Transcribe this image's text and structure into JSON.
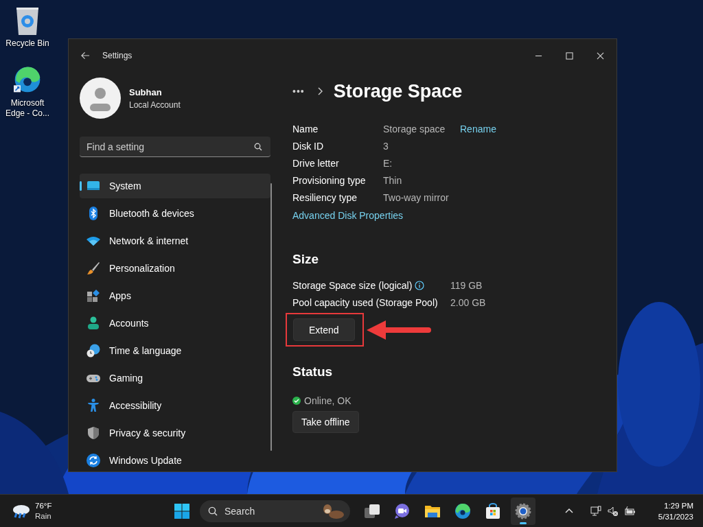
{
  "desktop_icons": [
    {
      "kind": "recycle",
      "label": "Recycle Bin"
    },
    {
      "kind": "edge",
      "label": "Microsoft Edge - Co..."
    }
  ],
  "window": {
    "title": "Settings"
  },
  "account": {
    "name": "Subhan",
    "type": "Local Account"
  },
  "search": {
    "placeholder": "Find a setting"
  },
  "nav": [
    {
      "kind": "system",
      "label": "System",
      "selected": true
    },
    {
      "kind": "bluetooth",
      "label": "Bluetooth & devices",
      "selected": false
    },
    {
      "kind": "network",
      "label": "Network & internet",
      "selected": false
    },
    {
      "kind": "personalization",
      "label": "Personalization",
      "selected": false
    },
    {
      "kind": "apps",
      "label": "Apps",
      "selected": false
    },
    {
      "kind": "accounts",
      "label": "Accounts",
      "selected": false
    },
    {
      "kind": "time",
      "label": "Time & language",
      "selected": false
    },
    {
      "kind": "gaming",
      "label": "Gaming",
      "selected": false
    },
    {
      "kind": "accessibility",
      "label": "Accessibility",
      "selected": false
    },
    {
      "kind": "privacy",
      "label": "Privacy & security",
      "selected": false
    },
    {
      "kind": "update",
      "label": "Windows Update",
      "selected": false
    }
  ],
  "breadcrumb": {
    "overflow": "•••",
    "title": "Storage Space"
  },
  "properties": [
    {
      "label": "Name",
      "value": "Storage space",
      "action": "Rename"
    },
    {
      "label": "Disk ID",
      "value": "3"
    },
    {
      "label": "Drive letter",
      "value": "E:"
    },
    {
      "label": "Provisioning type",
      "value": "Thin"
    },
    {
      "label": "Resiliency type",
      "value": "Two-way mirror"
    }
  ],
  "properties_link": "Advanced Disk Properties",
  "size": {
    "heading": "Size",
    "rows": [
      {
        "label": "Storage Space size (logical)",
        "info": true,
        "value": "119 GB"
      },
      {
        "label": "Pool capacity used (Storage Pool)",
        "info": false,
        "value": "2.00 GB"
      }
    ],
    "button": "Extend",
    "highlighted": true
  },
  "status": {
    "heading": "Status",
    "ok": true,
    "text": "Online, OK",
    "button": "Take offline"
  },
  "taskbar": {
    "weather": {
      "temp": "76°F",
      "condition": "Rain"
    },
    "search": {
      "placeholder": "Search"
    },
    "apps": [
      {
        "kind": "start",
        "active": false
      },
      {
        "kind": "taskview",
        "active": false
      },
      {
        "kind": "chat",
        "active": false
      },
      {
        "kind": "explorer",
        "active": false
      },
      {
        "kind": "edge",
        "active": false
      },
      {
        "kind": "store",
        "active": false
      },
      {
        "kind": "settings",
        "active": true
      }
    ],
    "time": "1:29 PM",
    "date": "5/31/2023"
  }
}
